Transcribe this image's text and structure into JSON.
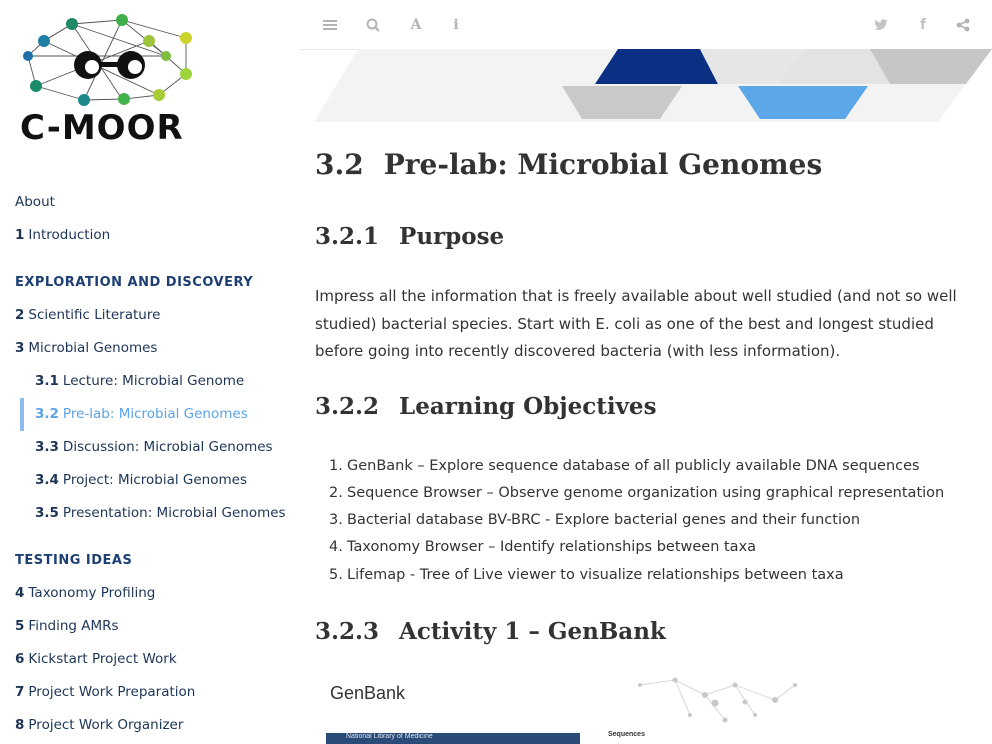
{
  "brand": {
    "logo_text": "C-MOOR"
  },
  "sidebar": {
    "items": [
      {
        "num": "",
        "label": "About"
      },
      {
        "num": "1",
        "label": "Introduction"
      },
      {
        "num": "2",
        "label": "Scientific Literature"
      },
      {
        "num": "3",
        "label": "Microbial Genomes"
      },
      {
        "num": "3.1",
        "label": "Lecture: Microbial Genome"
      },
      {
        "num": "3.2",
        "label": "Pre-lab: Microbial Genomes"
      },
      {
        "num": "3.3",
        "label": "Discussion: Microbial Genomes"
      },
      {
        "num": "3.4",
        "label": "Project: Microbial Genomes"
      },
      {
        "num": "3.5",
        "label": "Presentation: Microbial Genomes"
      },
      {
        "num": "4",
        "label": "Taxonomy Profiling"
      },
      {
        "num": "5",
        "label": "Finding AMRs"
      },
      {
        "num": "6",
        "label": "Kickstart Project Work"
      },
      {
        "num": "7",
        "label": "Project Work Preparation"
      },
      {
        "num": "8",
        "label": "Project Work Organizer"
      }
    ],
    "parts": [
      "EXPLORATION AND DISCOVERY",
      "TESTING IDEAS"
    ],
    "active_index": 5
  },
  "toolbar": {
    "icons": [
      "menu-icon",
      "search-icon",
      "font-icon",
      "info-icon",
      "twitter-icon",
      "facebook-icon",
      "share-icon"
    ],
    "glyph_font": "A",
    "glyph_info": "i",
    "glyph_twitter": "🐦",
    "glyph_facebook": "f"
  },
  "content": {
    "section_num": "3.2",
    "section_title": "Pre-lab: Microbial Genomes",
    "purpose_num": "3.2.1",
    "purpose_title": "Purpose",
    "purpose_text": "Impress all the information that is freely available about well studied (and not so well studied) bacterial species. Start with E. coli as one of the best and longest studied before going into recently discovered bacteria (with less information).",
    "objectives_num": "3.2.2",
    "objectives_title": "Learning Objectives",
    "objectives": [
      "GenBank – Explore sequence database of all publicly available DNA sequences",
      "Sequence Browser – Observe genome organization using graphical representation",
      "Bacterial database BV-BRC - Explore bacterial genes and their function",
      "Taxonomy Browser – Identify relationships between taxa",
      "Lifemap - Tree of Live viewer to visualize relationships between taxa"
    ],
    "activity_num": "3.2.3",
    "activity_title": "Activity 1 – GenBank",
    "figure": {
      "title": "GenBank",
      "bar_text": "National Library of Medicine",
      "side_label": "Sequences"
    }
  }
}
